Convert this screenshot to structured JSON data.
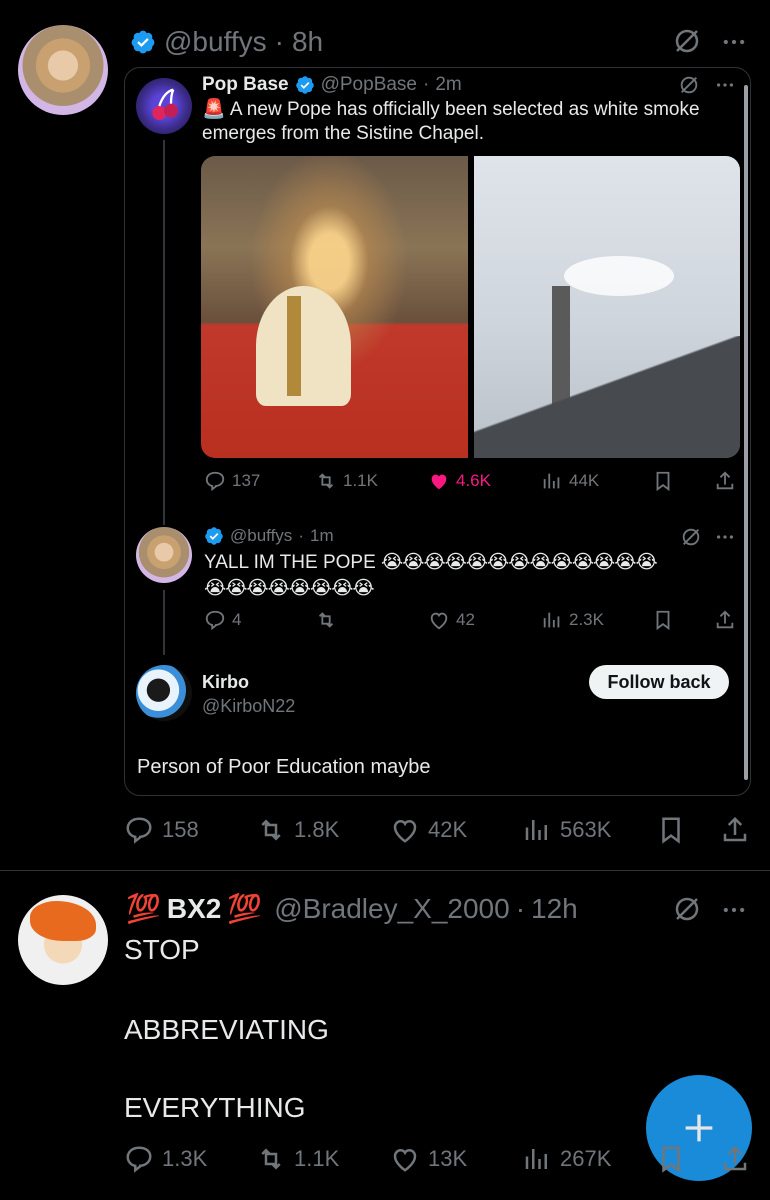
{
  "tweet1": {
    "handle": "@buffys",
    "time": "8h",
    "stats": {
      "replies": "158",
      "reposts": "1.8K",
      "likes": "42K",
      "views": "563K"
    }
  },
  "quote": {
    "name": "Pop Base",
    "handle": "@PopBase",
    "time": "2m",
    "alert_emoji": "🚨",
    "text_line1": "A new Pope has officially been selected as white smoke",
    "text_line2": "emerges from the Sistine Chapel.",
    "stats": {
      "replies": "137",
      "reposts": "1.1K",
      "likes": "4.6K",
      "views": "44K"
    }
  },
  "reply1": {
    "handle": "@buffys",
    "time": "1m",
    "text_prefix": "YALL IM THE POPE",
    "emoji_row1": "😭😭😭😭😭😭😭😭😭😭😭😭😭",
    "emoji_row2": "😭😭😭😭😭😭😭😭",
    "stats": {
      "replies": "4",
      "likes": "42",
      "views": "2.3K"
    }
  },
  "reply2": {
    "name": "Kirbo",
    "handle": "@KirboN22",
    "follow_label": "Follow back",
    "bio": "Person of Poor Education maybe"
  },
  "tweet2": {
    "hundred_left": "💯",
    "name": "BX2",
    "hundred_right": "💯",
    "handle": "@Bradley_X_2000",
    "time": "12h",
    "line1": "STOP",
    "line2": "ABBREVIATING",
    "line3": "EVERYTHING",
    "stats": {
      "replies": "1.3K",
      "reposts": "1.1K",
      "likes": "13K",
      "views": "267K"
    }
  },
  "colors": {
    "background": "#000000",
    "accent": "#1d9bf0",
    "like_active": "#f91880",
    "text": "#e7e9ea",
    "muted": "#71767b"
  }
}
